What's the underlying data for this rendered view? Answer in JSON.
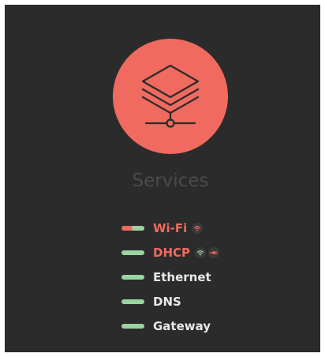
{
  "title": "Services",
  "colors": {
    "panel_background": "#2b2b2b",
    "accent": "#f06a5f",
    "ok": "#9bd3a1",
    "text": "#e8e8e8",
    "muted_title": "#4a4a4a"
  },
  "hero_icon": "layers-network-icon",
  "services": [
    {
      "label": "Wi-Fi",
      "status": "error",
      "badges": [
        "wifi-icon"
      ]
    },
    {
      "label": "DHCP",
      "status": "error",
      "badges": [
        "wifi-icon",
        "cable-plug-icon"
      ]
    },
    {
      "label": "Ethernet",
      "status": "ok",
      "badges": []
    },
    {
      "label": "DNS",
      "status": "ok",
      "badges": []
    },
    {
      "label": "Gateway",
      "status": "ok",
      "badges": []
    }
  ]
}
